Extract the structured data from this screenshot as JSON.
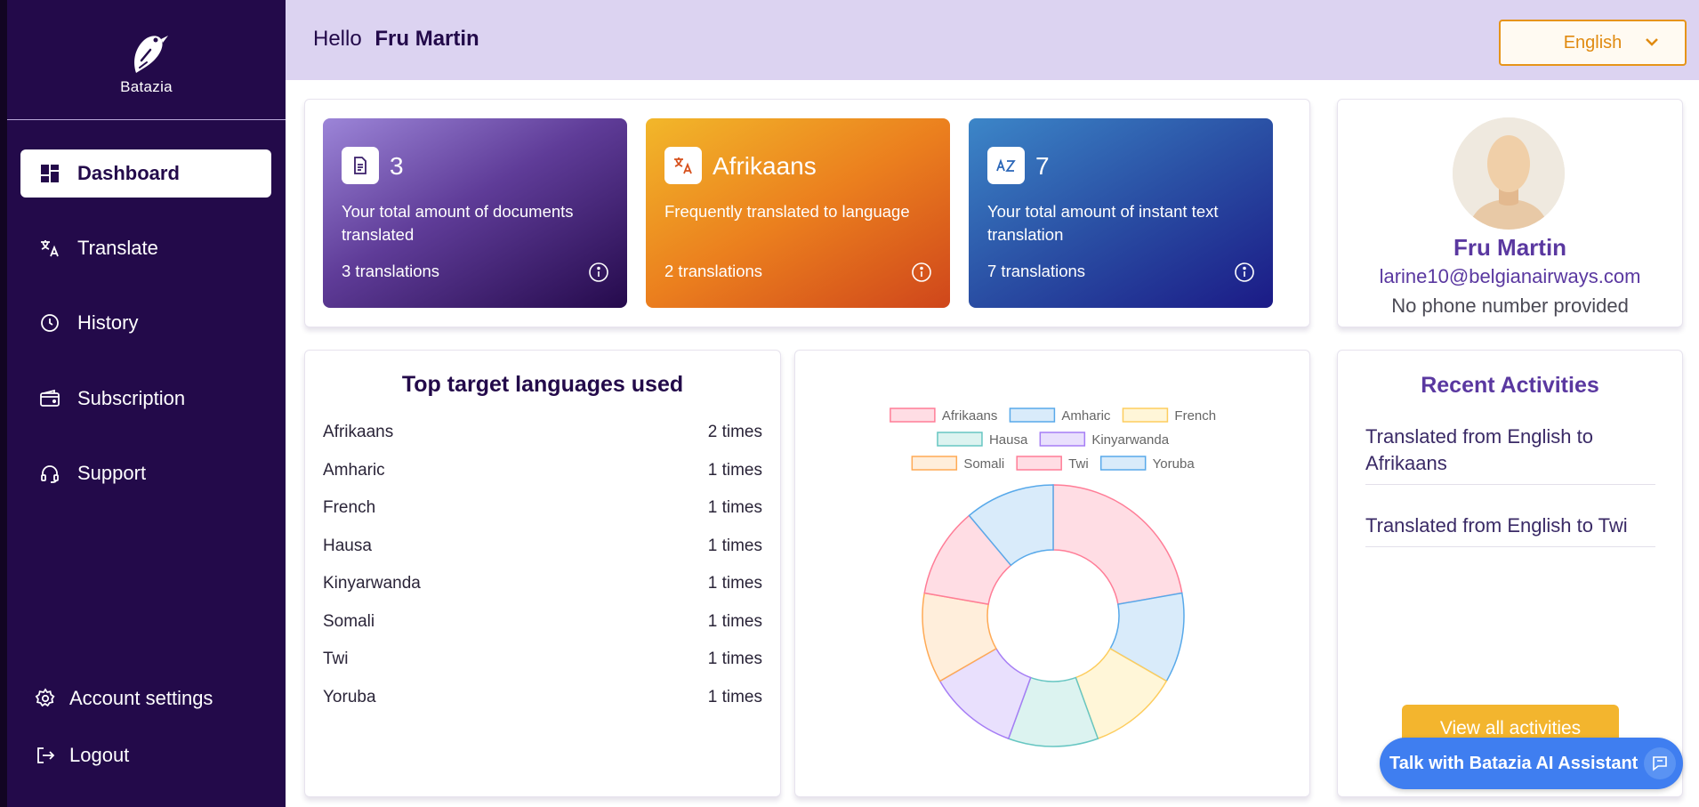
{
  "brand": {
    "name": "Batazia"
  },
  "sidebar": {
    "items": [
      {
        "label": "Dashboard",
        "icon": "dashboard-icon",
        "active": true
      },
      {
        "label": "Translate",
        "icon": "translate-icon",
        "active": false
      },
      {
        "label": "History",
        "icon": "clock-icon",
        "active": false
      },
      {
        "label": "Subscription",
        "icon": "wallet-icon",
        "active": false
      },
      {
        "label": "Support",
        "icon": "headset-icon",
        "active": false
      }
    ],
    "account_settings": "Account settings",
    "logout": "Logout"
  },
  "header": {
    "hello": "Hello",
    "user_name": "Fru Martin",
    "language": "English"
  },
  "stats": [
    {
      "icon": "document-icon",
      "value": "3",
      "description": "Your total amount of documents translated",
      "footer": "3 translations"
    },
    {
      "icon": "translate-icon",
      "value": "Afrikaans",
      "description": "Frequently translated to language",
      "footer": "2 translations"
    },
    {
      "icon": "az-text-icon",
      "value": "7",
      "description": "Your total amount of instant text translation",
      "footer": "7 translations"
    }
  ],
  "profile": {
    "name": "Fru Martin",
    "email": "larine10@belgianairways.com",
    "phone": "No phone number provided"
  },
  "top_languages": {
    "title": "Top target languages used",
    "rows": [
      {
        "language": "Afrikaans",
        "count": "2 times"
      },
      {
        "language": "Amharic",
        "count": "1 times"
      },
      {
        "language": "French",
        "count": "1 times"
      },
      {
        "language": "Hausa",
        "count": "1 times"
      },
      {
        "language": "Kinyarwanda",
        "count": "1 times"
      },
      {
        "language": "Somali",
        "count": "1 times"
      },
      {
        "language": "Twi",
        "count": "1 times"
      },
      {
        "language": "Yoruba",
        "count": "1 times"
      }
    ]
  },
  "chart_data": {
    "type": "pie",
    "variant": "doughnut",
    "legend_position": "top",
    "categories": [
      "Afrikaans",
      "Amharic",
      "French",
      "Hausa",
      "Kinyarwanda",
      "Somali",
      "Twi",
      "Yoruba"
    ],
    "values": [
      2,
      1,
      1,
      1,
      1,
      1,
      1,
      1
    ],
    "colors": {
      "fill": [
        "#ffdde4",
        "#d9ebfa",
        "#fff6d8",
        "#dcf3f0",
        "#e9e0fd",
        "#ffeedb",
        "#ffdde4",
        "#d9ebfa"
      ],
      "stroke": [
        "#ff7d97",
        "#58a9ea",
        "#fdcd5e",
        "#67c6c2",
        "#a67ef5",
        "#ffaa55",
        "#ff7d97",
        "#58a9ea"
      ]
    }
  },
  "activities": {
    "title": "Recent Activities",
    "items": [
      "Translated from English to Afrikaans",
      "Translated from English to Twi"
    ],
    "view_all": "View all activities"
  },
  "assistant": {
    "label": "Talk with Batazia AI Assistant"
  }
}
